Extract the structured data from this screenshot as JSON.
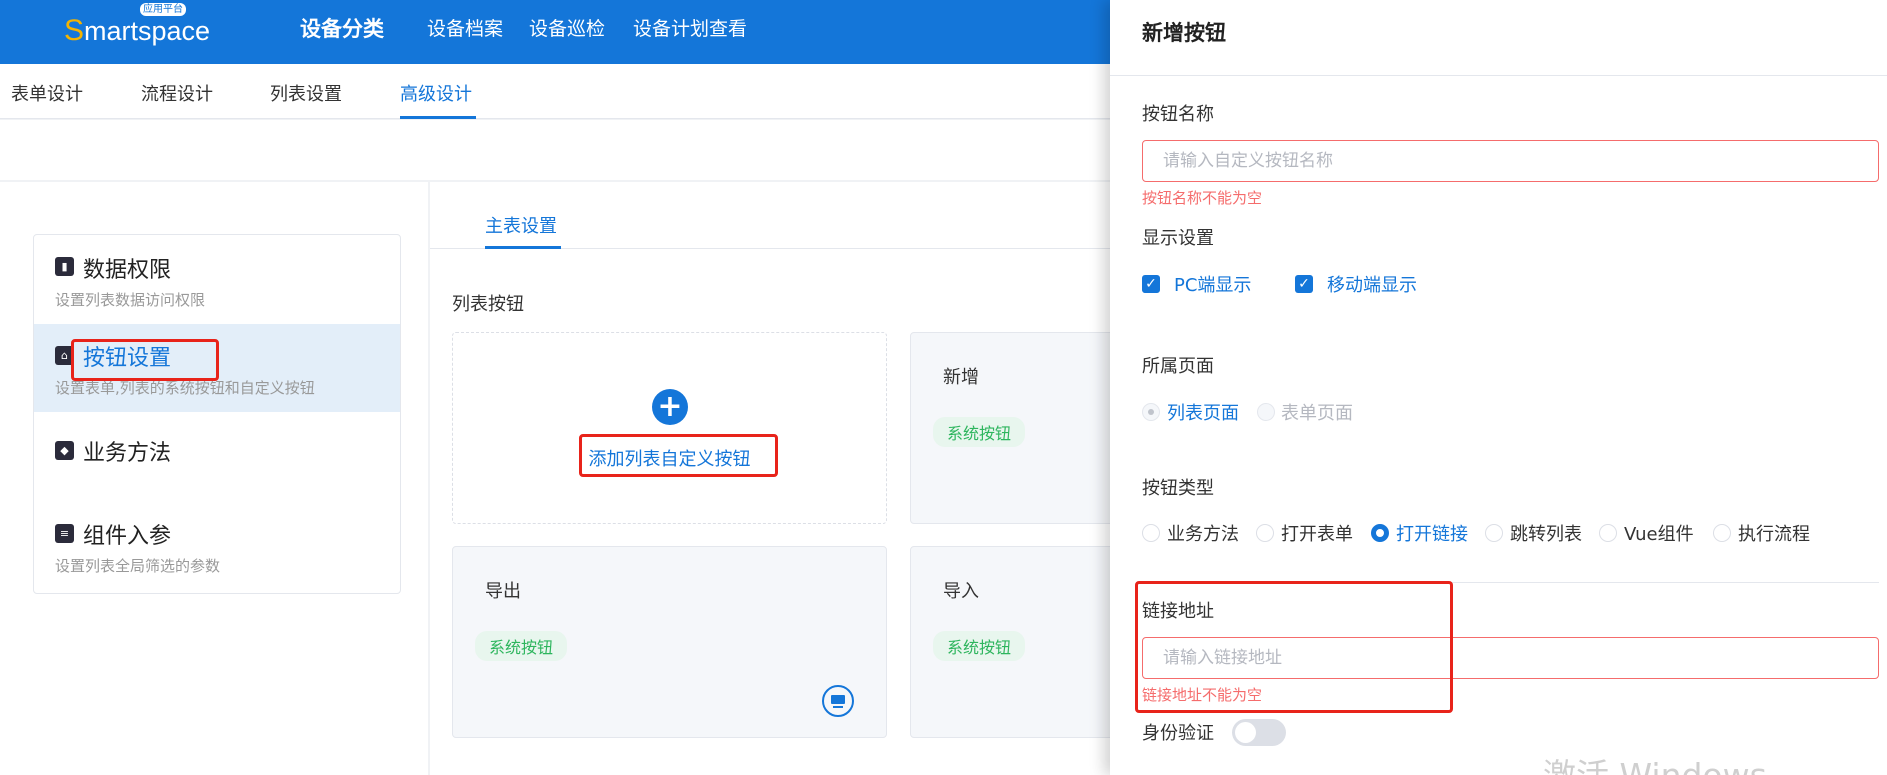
{
  "header": {
    "logo_s": "S",
    "logo_rest": "martspace",
    "logo_badge": "应用平台",
    "nav_main": "设备分类",
    "nav": [
      "设备档案",
      "设备巡检",
      "设备计划查看"
    ]
  },
  "subtabs": {
    "items": [
      "表单设计",
      "流程设计",
      "列表设置",
      "高级设计"
    ],
    "active": "高级设计"
  },
  "left_menu": {
    "items": [
      {
        "icon": "chart-icon",
        "title": "数据权限",
        "desc": "设置列表数据访问权限"
      },
      {
        "icon": "bag-icon",
        "title": "按钮设置",
        "desc": "设置表单,列表的系统按钮和自定义按钮",
        "active": true
      },
      {
        "icon": "cube-icon",
        "title": "业务方法",
        "desc": ""
      },
      {
        "icon": "sliders-icon",
        "title": "组件入参",
        "desc": "设置列表全局筛选的参数"
      }
    ]
  },
  "center": {
    "tab": "主表设置",
    "section_label": "列表按钮",
    "add_button_label": "添加列表自定义按钮",
    "cards": [
      {
        "name": "新增",
        "tag": "系统按钮"
      },
      {
        "name": "导出",
        "tag": "系统按钮"
      },
      {
        "name": "导入",
        "tag": "系统按钮"
      }
    ]
  },
  "drawer": {
    "title": "新增按钮",
    "name_label": "按钮名称",
    "name_placeholder": "请输入自定义按钮名称",
    "name_error": "按钮名称不能为空",
    "display_label": "显示设置",
    "display_options": [
      "PC端显示",
      "移动端显示"
    ],
    "page_label": "所属页面",
    "page_options": [
      {
        "label": "列表页面",
        "checked": true,
        "disabled": true
      },
      {
        "label": "表单页面",
        "checked": false,
        "disabled": true
      }
    ],
    "type_label": "按钮类型",
    "type_options": [
      {
        "label": "业务方法",
        "checked": false
      },
      {
        "label": "打开表单",
        "checked": false
      },
      {
        "label": "打开链接",
        "checked": true
      },
      {
        "label": "跳转列表",
        "checked": false
      },
      {
        "label": "Vue组件",
        "checked": false
      },
      {
        "label": "执行流程",
        "checked": false
      }
    ],
    "link_label": "链接地址",
    "link_placeholder": "请输入链接地址",
    "link_error": "链接地址不能为空",
    "auth_label": "身份验证",
    "auth_enabled": false
  },
  "watermark": "激活 Windows",
  "colors": {
    "primary": "#1476d9",
    "error": "#f56c6c",
    "success": "#2db55d",
    "annotation": "#e8231a"
  }
}
